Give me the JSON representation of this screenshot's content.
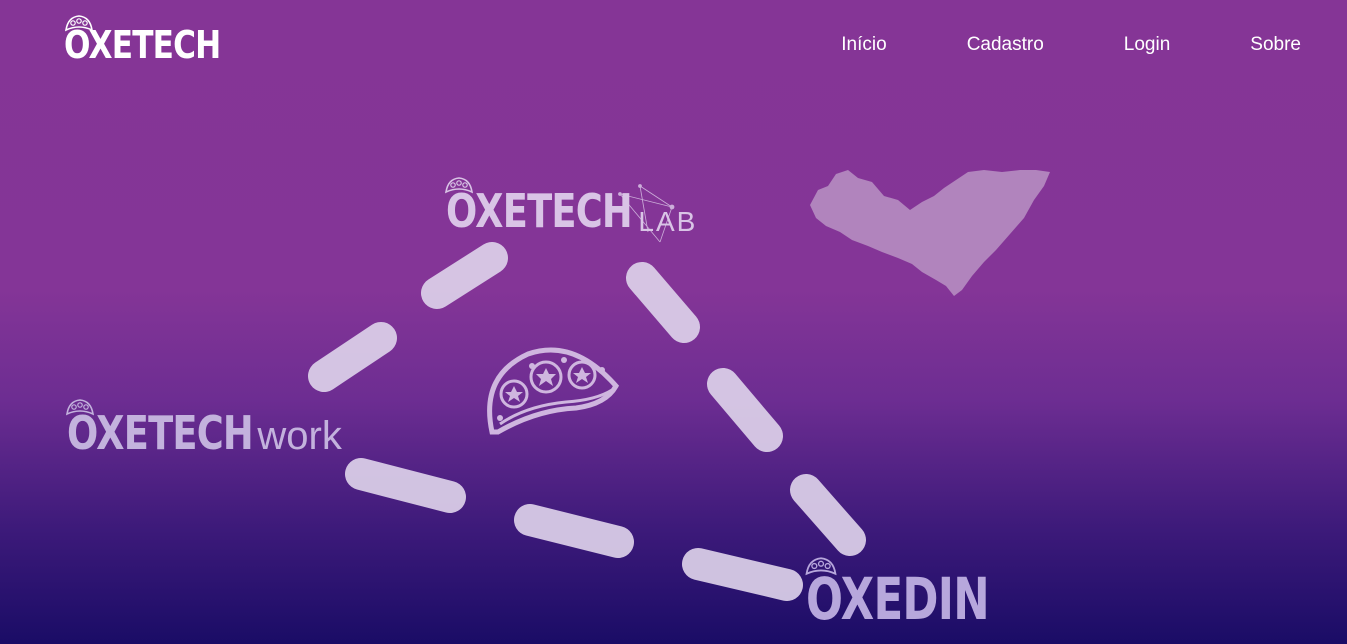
{
  "header": {
    "brand": "OXETECH",
    "nav": [
      {
        "label": "Início"
      },
      {
        "label": "Cadastro"
      },
      {
        "label": "Login"
      },
      {
        "label": "Sobre"
      }
    ]
  },
  "hero": {
    "lab_logo": {
      "word": "OXETECH",
      "suffix": "LAB"
    },
    "work_logo": {
      "word": "OXETECH",
      "suffix": "work"
    },
    "din_logo": {
      "word": "OXEDIN"
    },
    "center_icon": "empanada-icon",
    "map_icon": "alagoas-map-icon"
  },
  "colors": {
    "bg_top": "#853596",
    "bg_bottom": "#1a0c66",
    "dash": "#ddd1ea",
    "map": "#b184bd"
  }
}
